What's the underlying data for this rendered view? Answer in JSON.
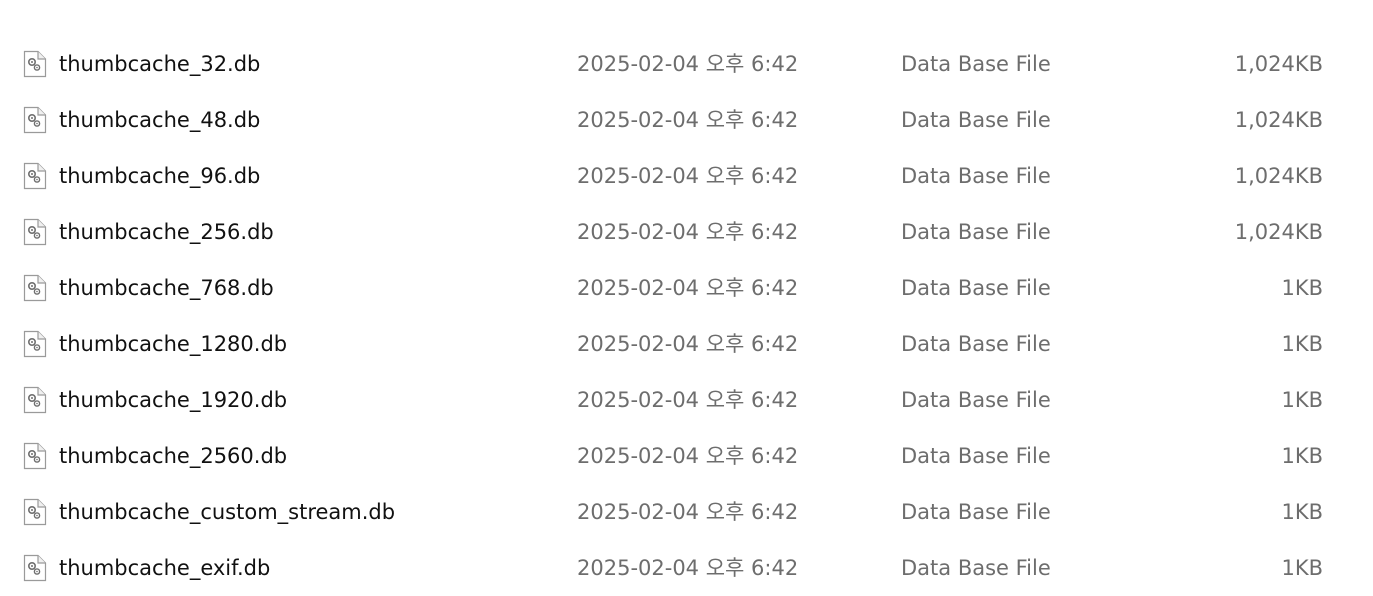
{
  "file_list": {
    "rows": [
      {
        "name": "",
        "date": "",
        "type": "",
        "size": "",
        "partial": true
      },
      {
        "name": "thumbcache_32.db",
        "date": "2025-02-04 오후 6:42",
        "type": "Data Base File",
        "size": "1,024KB"
      },
      {
        "name": "thumbcache_48.db",
        "date": "2025-02-04 오후 6:42",
        "type": "Data Base File",
        "size": "1,024KB"
      },
      {
        "name": "thumbcache_96.db",
        "date": "2025-02-04 오후 6:42",
        "type": "Data Base File",
        "size": "1,024KB"
      },
      {
        "name": "thumbcache_256.db",
        "date": "2025-02-04 오후 6:42",
        "type": "Data Base File",
        "size": "1,024KB"
      },
      {
        "name": "thumbcache_768.db",
        "date": "2025-02-04 오후 6:42",
        "type": "Data Base File",
        "size": "1KB"
      },
      {
        "name": "thumbcache_1280.db",
        "date": "2025-02-04 오후 6:42",
        "type": "Data Base File",
        "size": "1KB"
      },
      {
        "name": "thumbcache_1920.db",
        "date": "2025-02-04 오후 6:42",
        "type": "Data Base File",
        "size": "1KB"
      },
      {
        "name": "thumbcache_2560.db",
        "date": "2025-02-04 오후 6:42",
        "type": "Data Base File",
        "size": "1KB"
      },
      {
        "name": "thumbcache_custom_stream.db",
        "date": "2025-02-04 오후 6:42",
        "type": "Data Base File",
        "size": "1KB"
      },
      {
        "name": "thumbcache_exif.db",
        "date": "2025-02-04 오후 6:42",
        "type": "Data Base File",
        "size": "1KB"
      }
    ],
    "icon": "database-file-icon",
    "colors": {
      "name_text": "#111111",
      "meta_text": "#6d6d6d",
      "background": "#ffffff"
    }
  }
}
